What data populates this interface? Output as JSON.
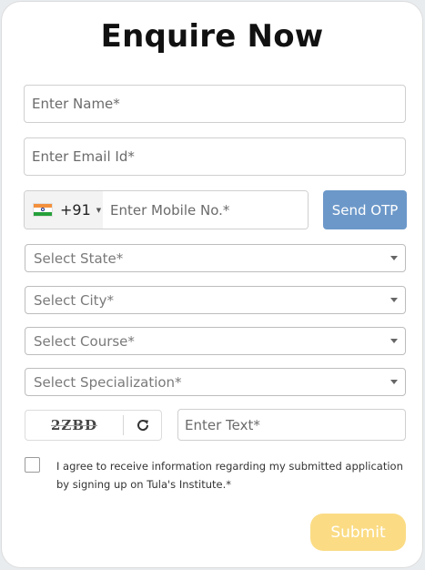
{
  "form": {
    "title": "Enquire Now",
    "name_placeholder": "Enter Name*",
    "email_placeholder": "Enter Email Id*",
    "phone": {
      "country_flag": "india-flag",
      "dial_code": "+91",
      "placeholder": "Enter Mobile No.*"
    },
    "otp_label": "Send OTP",
    "selects": [
      {
        "label": "Select State*"
      },
      {
        "label": "Select City*"
      },
      {
        "label": "Select Course*"
      },
      {
        "label": "Select Specialization*"
      }
    ],
    "captcha": {
      "code": "2ZBD",
      "refresh_icon": "refresh-icon",
      "placeholder": "Enter Text*"
    },
    "consent_text": "I agree to receive information regarding my submitted application by signing up on Tula's Institute.*",
    "submit_label": "Submit"
  },
  "colors": {
    "otp_button": "#6c98c9",
    "submit_button": "#fbdc85"
  }
}
